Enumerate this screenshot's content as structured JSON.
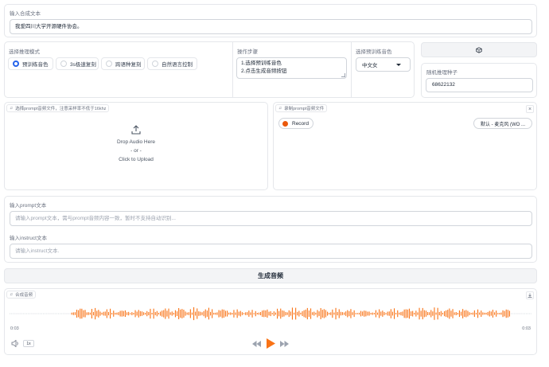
{
  "synthesis_text": {
    "label": "输入合成文本",
    "value": "我爱四川大学开源硬件协会。"
  },
  "mode": {
    "label": "选择推理模式",
    "options": [
      "预训练音色",
      "3s极速复刻",
      "跨语种复刻",
      "自然语言控制"
    ],
    "selected": "预训练音色"
  },
  "steps": {
    "label": "操作步骤",
    "line1": "1.选择预训练音色",
    "line2": "2.点击生成音频按钮"
  },
  "voice": {
    "label": "选择预训练音色",
    "value": "中文女"
  },
  "seed": {
    "dice_icon": "dice-icon",
    "label": "随机推理种子",
    "value": "68622132"
  },
  "prompt_upload": {
    "tag": "选择prompt音频文件，注意采样率不低于16khz",
    "drop_line1": "Drop Audio Here",
    "drop_line2": "- or -",
    "drop_line3": "Click to Upload"
  },
  "prompt_record": {
    "tag": "录制prompt音频文件",
    "record_label": "Record",
    "mic_select": "默认 - 麦克风 (WO ...",
    "close": "×"
  },
  "prompt_text": {
    "label": "输入prompt文本",
    "placeholder": "请输入prompt文本，需与prompt音频内容一致，暂时不支持自动识别..."
  },
  "instruct_text": {
    "label": "输入instruct文本",
    "placeholder": "请输入instruct文本."
  },
  "generate_button": "生成音频",
  "output_audio": {
    "tag": "合成音频",
    "time_start": "0:03",
    "time_end": "0:03",
    "speed": "1x",
    "accent_color": "#f97316"
  },
  "colors": {
    "accent": "#f97316",
    "radio_selected": "#2563eb"
  }
}
